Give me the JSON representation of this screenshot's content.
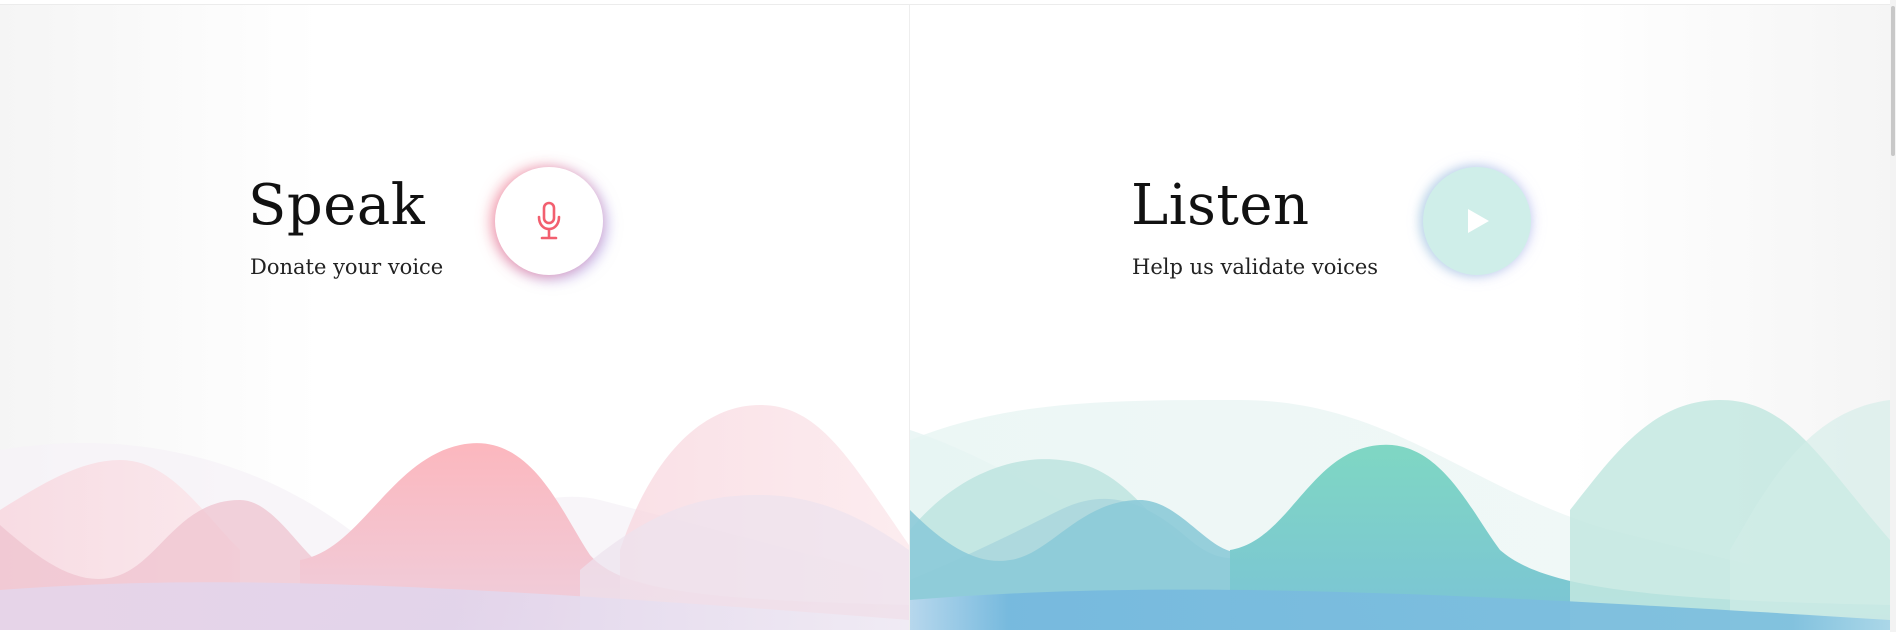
{
  "speak": {
    "title": "Speak",
    "subtitle": "Donate your voice",
    "button_icon": "microphone-icon",
    "accent_color": "#f25f6f"
  },
  "listen": {
    "title": "Listen",
    "subtitle": "Help us validate voices",
    "button_icon": "play-icon",
    "accent_color": "#59cbb7"
  }
}
